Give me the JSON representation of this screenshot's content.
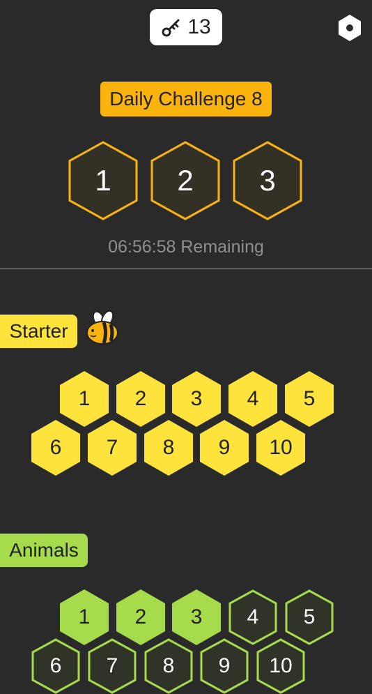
{
  "header": {
    "keys_count": "13",
    "key_icon": "key-icon",
    "settings_icon": "hexagon-settings-icon"
  },
  "daily": {
    "label": "Daily Challenge 8",
    "levels": [
      "1",
      "2",
      "3"
    ],
    "remaining": "06:56:58 Remaining"
  },
  "starter": {
    "label": "Starter",
    "icon": "bee-icon",
    "levels": [
      "1",
      "2",
      "3",
      "4",
      "5",
      "6",
      "7",
      "8",
      "9",
      "10"
    ]
  },
  "animals": {
    "label": "Animals",
    "levels": [
      "1",
      "2",
      "3",
      "4",
      "5",
      "6",
      "7",
      "8",
      "9",
      "10"
    ],
    "completed_count": 3
  },
  "colors": {
    "background": "#2a2a2a",
    "daily_accent": "#fbb30e",
    "starter_yellow": "#fde33c",
    "animals_green": "#a6dc4c",
    "divider": "#5c5c5c"
  }
}
